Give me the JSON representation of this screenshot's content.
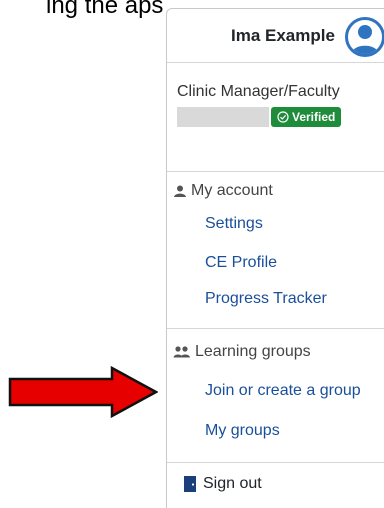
{
  "top_fragment": "ing the aps",
  "user": {
    "name": "Ima Example",
    "role": "Clinic Manager/Faculty",
    "verified_label": "Verified"
  },
  "menu": {
    "account": {
      "heading": "My account",
      "links": [
        "Settings",
        "CE Profile",
        "Progress Tracker"
      ]
    },
    "groups": {
      "heading": "Learning groups",
      "links": [
        "Join or create a group",
        "My groups"
      ]
    },
    "signout": "Sign out"
  },
  "colors": {
    "link": "#1a4f9c",
    "verified": "#1e8c3a",
    "avatar_ring": "#2f74c0",
    "arrow": "#e60000"
  },
  "icons": [
    "user-avatar-icon",
    "check-circle-icon",
    "person-icon",
    "people-icon",
    "door-icon",
    "red-arrow"
  ]
}
